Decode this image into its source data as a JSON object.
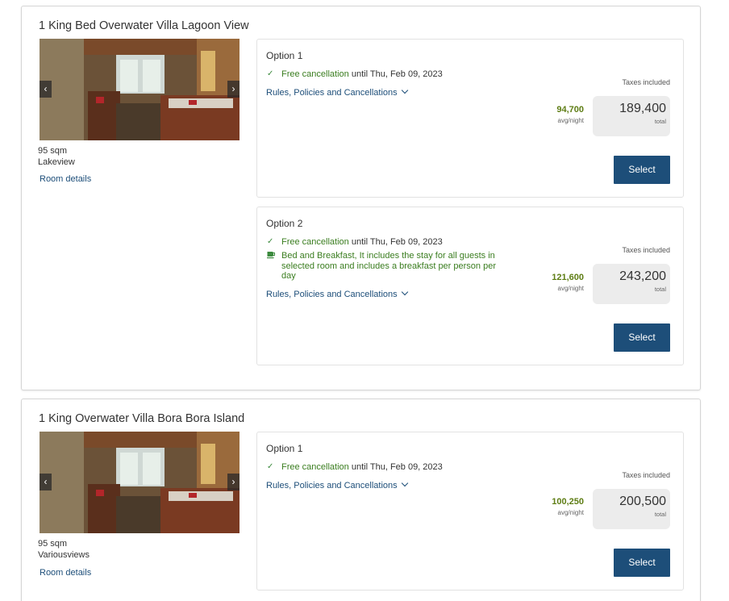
{
  "rooms": [
    {
      "title": "1 King Bed Overwater Villa Lagoon View",
      "size": "95 sqm",
      "view": "Lakeview",
      "details_link": "Room details",
      "options": [
        {
          "title": "Option 1",
          "cancellation_label": "Free cancellation",
          "cancellation_until": " until Thu, Feb 09, 2023",
          "rules_link": "Rules, Policies and Cancellations",
          "taxes": "Taxes included",
          "avg_price": "94,700",
          "avg_label": "avg/night",
          "total_price": "189,400",
          "total_label": "total",
          "select_label": "Select"
        },
        {
          "title": "Option 2",
          "cancellation_label": "Free cancellation",
          "cancellation_until": " until Thu, Feb 09, 2023",
          "meal_text": "Bed and Breakfast, It includes the stay for all guests in selected room and includes a breakfast per person per day",
          "rules_link": "Rules, Policies and Cancellations",
          "taxes": "Taxes included",
          "avg_price": "121,600",
          "avg_label": "avg/night",
          "total_price": "243,200",
          "total_label": "total",
          "select_label": "Select"
        }
      ]
    },
    {
      "title": "1 King Overwater Villa Bora Bora Island",
      "size": "95 sqm",
      "view": "Variousviews",
      "details_link": "Room details",
      "options": [
        {
          "title": "Option 1",
          "cancellation_label": "Free cancellation",
          "cancellation_until": " until Thu, Feb 09, 2023",
          "rules_link": "Rules, Policies and Cancellations",
          "taxes": "Taxes included",
          "avg_price": "100,250",
          "avg_label": "avg/night",
          "total_price": "200,500",
          "total_label": "total",
          "select_label": "Select"
        }
      ]
    }
  ],
  "colors": {
    "primary_button": "#1d4e79",
    "link": "#1d4e79",
    "price_green": "#5e7d14",
    "feature_green": "#3a7d1f"
  },
  "icons": {
    "check": "check-icon",
    "coffee": "coffee-cup-icon",
    "prev": "chevron-left-icon",
    "next": "chevron-right-icon",
    "dropdown": "chevron-down-icon"
  }
}
